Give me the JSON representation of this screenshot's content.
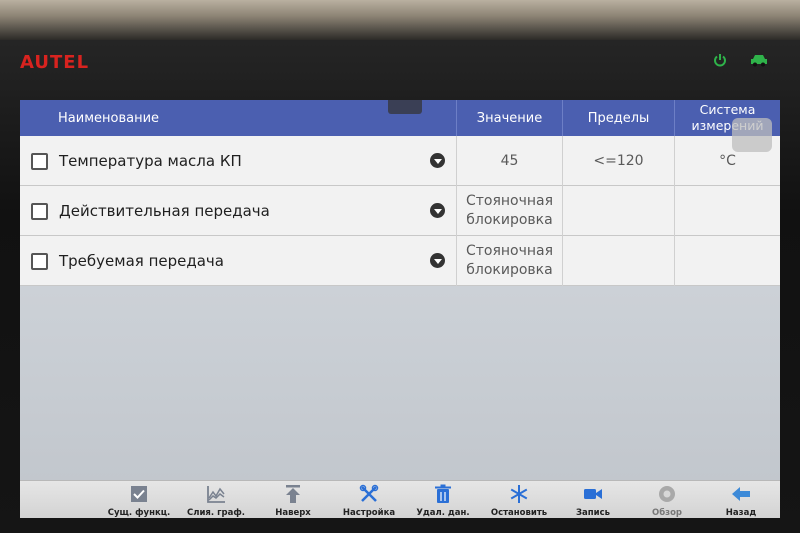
{
  "device": {
    "brand": "AUTEL",
    "status_icons": [
      "power-icon",
      "car-icon"
    ],
    "brand_color": "#d8231f",
    "status_color": "#2fb34a"
  },
  "table": {
    "headers": {
      "name": "Наименование",
      "value": "Значение",
      "limits": "Пределы",
      "units": "Система измерений"
    },
    "rows": [
      {
        "name": "Температура масла КП",
        "value": "45",
        "limits": "<=120",
        "units": "°C"
      },
      {
        "name": "Действительная передача",
        "value": "Стояночная блокировка",
        "limits": "",
        "units": ""
      },
      {
        "name": "Требуемая передача",
        "value": "Стояночная блокировка",
        "limits": "",
        "units": ""
      }
    ]
  },
  "toolbar": {
    "items": [
      {
        "label": "Сущ. функц.",
        "icon": "checkbox-icon"
      },
      {
        "label": "Слия. граф.",
        "icon": "graph-icon"
      },
      {
        "label": "Наверх",
        "icon": "arrow-up-icon"
      },
      {
        "label": "Настройка",
        "icon": "tools-icon"
      },
      {
        "label": "Удал. дан.",
        "icon": "trash-icon"
      },
      {
        "label": "Остановить",
        "icon": "snowflake-icon"
      },
      {
        "label": "Запись",
        "icon": "video-camera-icon"
      },
      {
        "label": "Обзор",
        "icon": "review-icon"
      },
      {
        "label": "Назад",
        "icon": "back-arrow-icon"
      }
    ]
  },
  "colors": {
    "header_bg": "#4b5fb0",
    "accent_blue": "#2a6fd6"
  }
}
